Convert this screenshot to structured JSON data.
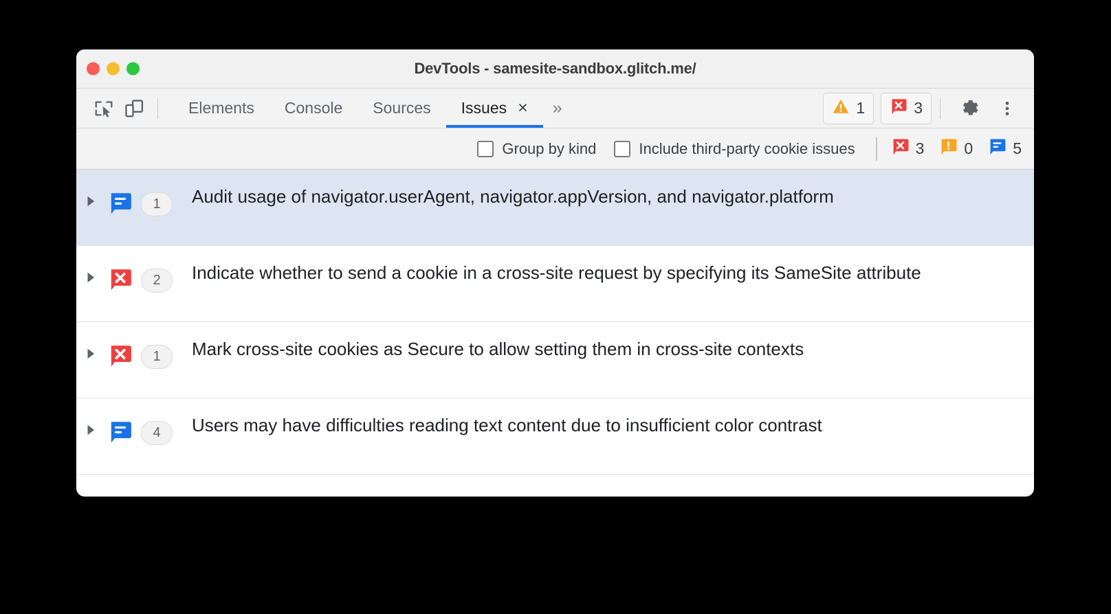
{
  "window": {
    "title": "DevTools - samesite-sandbox.glitch.me/",
    "traffic_lights": [
      {
        "name": "close",
        "color": "#fa5d55"
      },
      {
        "name": "minimize",
        "color": "#f6bd31"
      },
      {
        "name": "zoom",
        "color": "#2bc840"
      }
    ]
  },
  "toolbar": {
    "left_icons": [
      {
        "name": "inspect-element-icon",
        "label": "Inspect element"
      },
      {
        "name": "device-toolbar-icon",
        "label": "Toggle device toolbar"
      }
    ],
    "tabs": [
      {
        "label": "Elements",
        "active": false,
        "closable": false
      },
      {
        "label": "Console",
        "active": false,
        "closable": false
      },
      {
        "label": "Sources",
        "active": false,
        "closable": false
      },
      {
        "label": "Issues",
        "active": true,
        "closable": true
      }
    ],
    "tab_close_glyph": "×",
    "more_tabs_glyph": "»",
    "warning_count": "1",
    "error_count": "3",
    "gear_label": "Settings",
    "kebab_label": "Customize and control DevTools"
  },
  "filters": {
    "checkboxes": [
      {
        "label": "Group by kind",
        "checked": false
      },
      {
        "label": "Include third-party cookie issues",
        "checked": false
      }
    ],
    "counts": [
      {
        "kind": "error",
        "value": "3"
      },
      {
        "kind": "warning",
        "value": "0"
      },
      {
        "kind": "info",
        "value": "5"
      }
    ]
  },
  "issues": [
    {
      "kind": "info",
      "count": "1",
      "title": "Audit usage of navigator.userAgent, navigator.appVersion, and navigator.platform",
      "selected": true,
      "expanded": false
    },
    {
      "kind": "error",
      "count": "2",
      "title": "Indicate whether to send a cookie in a cross-site request by specifying its SameSite attribute",
      "selected": false,
      "expanded": false
    },
    {
      "kind": "error",
      "count": "1",
      "title": "Mark cross-site cookies as Secure to allow setting them in cross-site contexts",
      "selected": false,
      "expanded": false
    },
    {
      "kind": "info",
      "count": "4",
      "title": "Users may have difficulties reading text content due to insufficient color contrast",
      "selected": false,
      "expanded": false
    }
  ],
  "colors": {
    "accent": "#1a73e8",
    "error": "#ef4040",
    "warning": "#f5a623",
    "info": "#1a73e8",
    "selected_row": "#dde5f2"
  }
}
